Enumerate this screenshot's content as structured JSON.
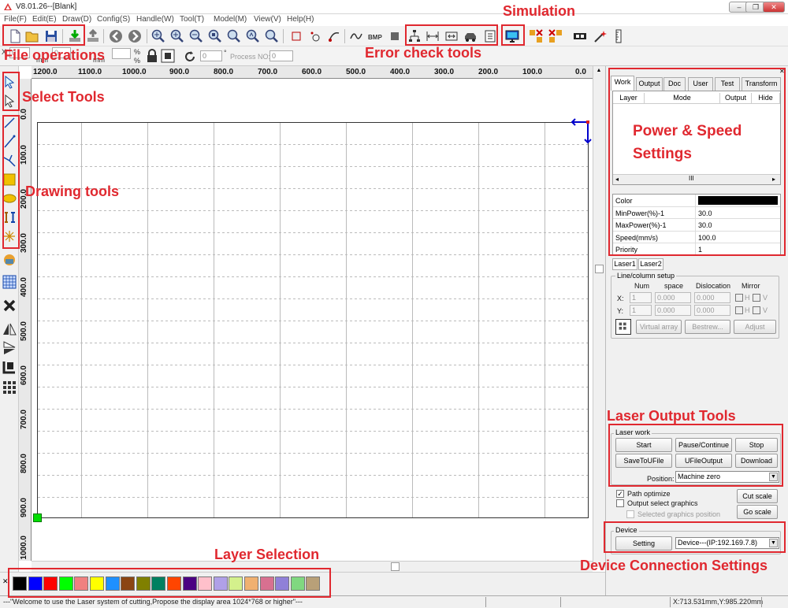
{
  "window": {
    "title": "V8.01.26--[Blank]",
    "minimize": "–",
    "restore": "❐",
    "close": "✕"
  },
  "menu": [
    "File(F)",
    "Edit(E)",
    "Draw(D)",
    "Config(S)",
    "Handle(W)",
    "Tool(T)",
    "Model(M)",
    "View(V)",
    "Help(H)"
  ],
  "toolbar2": {
    "pct_top": "%",
    "pct_bottom": "%",
    "mm1": "mm",
    "mm2": "mm",
    "val_x": "0",
    "val_y": "0",
    "rotation_value": "0",
    "degree": "°",
    "process_no_label": "Process NO:",
    "process_no_value": "0"
  },
  "ruler": {
    "h_ticks": [
      "1200.0",
      "1100.0",
      "1000.0",
      "900.0",
      "800.0",
      "700.0",
      "600.0",
      "500.0",
      "400.0",
      "300.0",
      "200.0",
      "100.0",
      "0.0"
    ],
    "v_ticks": [
      "0.0",
      "100.0",
      "200.0",
      "300.0",
      "400.0",
      "500.0",
      "600.0",
      "700.0",
      "800.0",
      "900.0",
      "1000.0"
    ]
  },
  "right_panel": {
    "tabs": [
      "Work",
      "Output",
      "Doc",
      "User",
      "Test",
      "Transform"
    ],
    "active_tab": "Work",
    "layer_columns": [
      "Layer",
      "Mode",
      "Output",
      "Hide"
    ],
    "scroll_thumb": "III",
    "properties": [
      {
        "key": "Color",
        "value": ""
      },
      {
        "key": "MinPower(%)-1",
        "value": "30.0"
      },
      {
        "key": "MaxPower(%)-1",
        "value": "30.0"
      },
      {
        "key": "Speed(mm/s)",
        "value": "100.0"
      },
      {
        "key": "Priority",
        "value": "1"
      }
    ],
    "color_value": "#000000",
    "laser_tabs": [
      "Laser1",
      "Laser2"
    ],
    "line_column": {
      "title": "Line/column setup",
      "headers": [
        "Num",
        "space",
        "Dislocation",
        "Mirror"
      ],
      "x_label": "X:",
      "y_label": "Y:",
      "x_num": "1",
      "x_space": "0.000",
      "x_disloc": "0.000",
      "y_num": "1",
      "y_space": "0.000",
      "y_disloc": "0.000",
      "mirror_h": "H",
      "mirror_v": "V",
      "virtual_array": "Virtual array",
      "bestrew": "Bestrew...",
      "adjust": "Adjust"
    },
    "laser_work": {
      "title": "Laser work",
      "start": "Start",
      "pause": "Pause/Continue",
      "stop": "Stop",
      "save_u": "SaveToUFile",
      "ufile_output": "UFileOutput",
      "download": "Download",
      "position_label": "Position:",
      "position_value": "Machine zero"
    },
    "options": {
      "path_optimize": "Path optimize",
      "path_optimize_checked": "✓",
      "output_select": "Output select graphics",
      "selected_pos": "Selected graphics position",
      "cut_scale": "Cut scale",
      "go_scale": "Go scale"
    },
    "device": {
      "title": "Device",
      "setting": "Setting",
      "value": "Device---(IP:192.169.7.8)"
    }
  },
  "palette": [
    "#000000",
    "#0000ff",
    "#ff0000",
    "#00ff00",
    "#f08080",
    "#ffff00",
    "#1e90ff",
    "#8b4513",
    "#808000",
    "#008060",
    "#ff4500",
    "#4b0082",
    "#ffc0cb",
    "#b0a0e8",
    "#d4f08c",
    "#f0b070",
    "#d87090",
    "#9080d8",
    "#80d880",
    "#b8a078"
  ],
  "status": {
    "message": "---\"Welcome to use the Laser system of cutting,Propose the display area 1024*768 or higher\"---",
    "coords": "X:713.531mm,Y:985.220mm"
  },
  "annotations": {
    "file_ops": "File operations",
    "select_tools": "Select Tools",
    "drawing_tools": "Drawing tools",
    "simulation": "Simulation",
    "error_check": "Error check tools",
    "power_speed_1": "Power & Speed",
    "power_speed_2": "Settings",
    "laser_output": "Laser Output Tools",
    "layer_selection": "Layer Selection",
    "device_conn": "Device Connection Settings"
  },
  "colors": {
    "annotation": "#e0282f",
    "origin": "#00dd00",
    "arrow": "#0000cc"
  }
}
